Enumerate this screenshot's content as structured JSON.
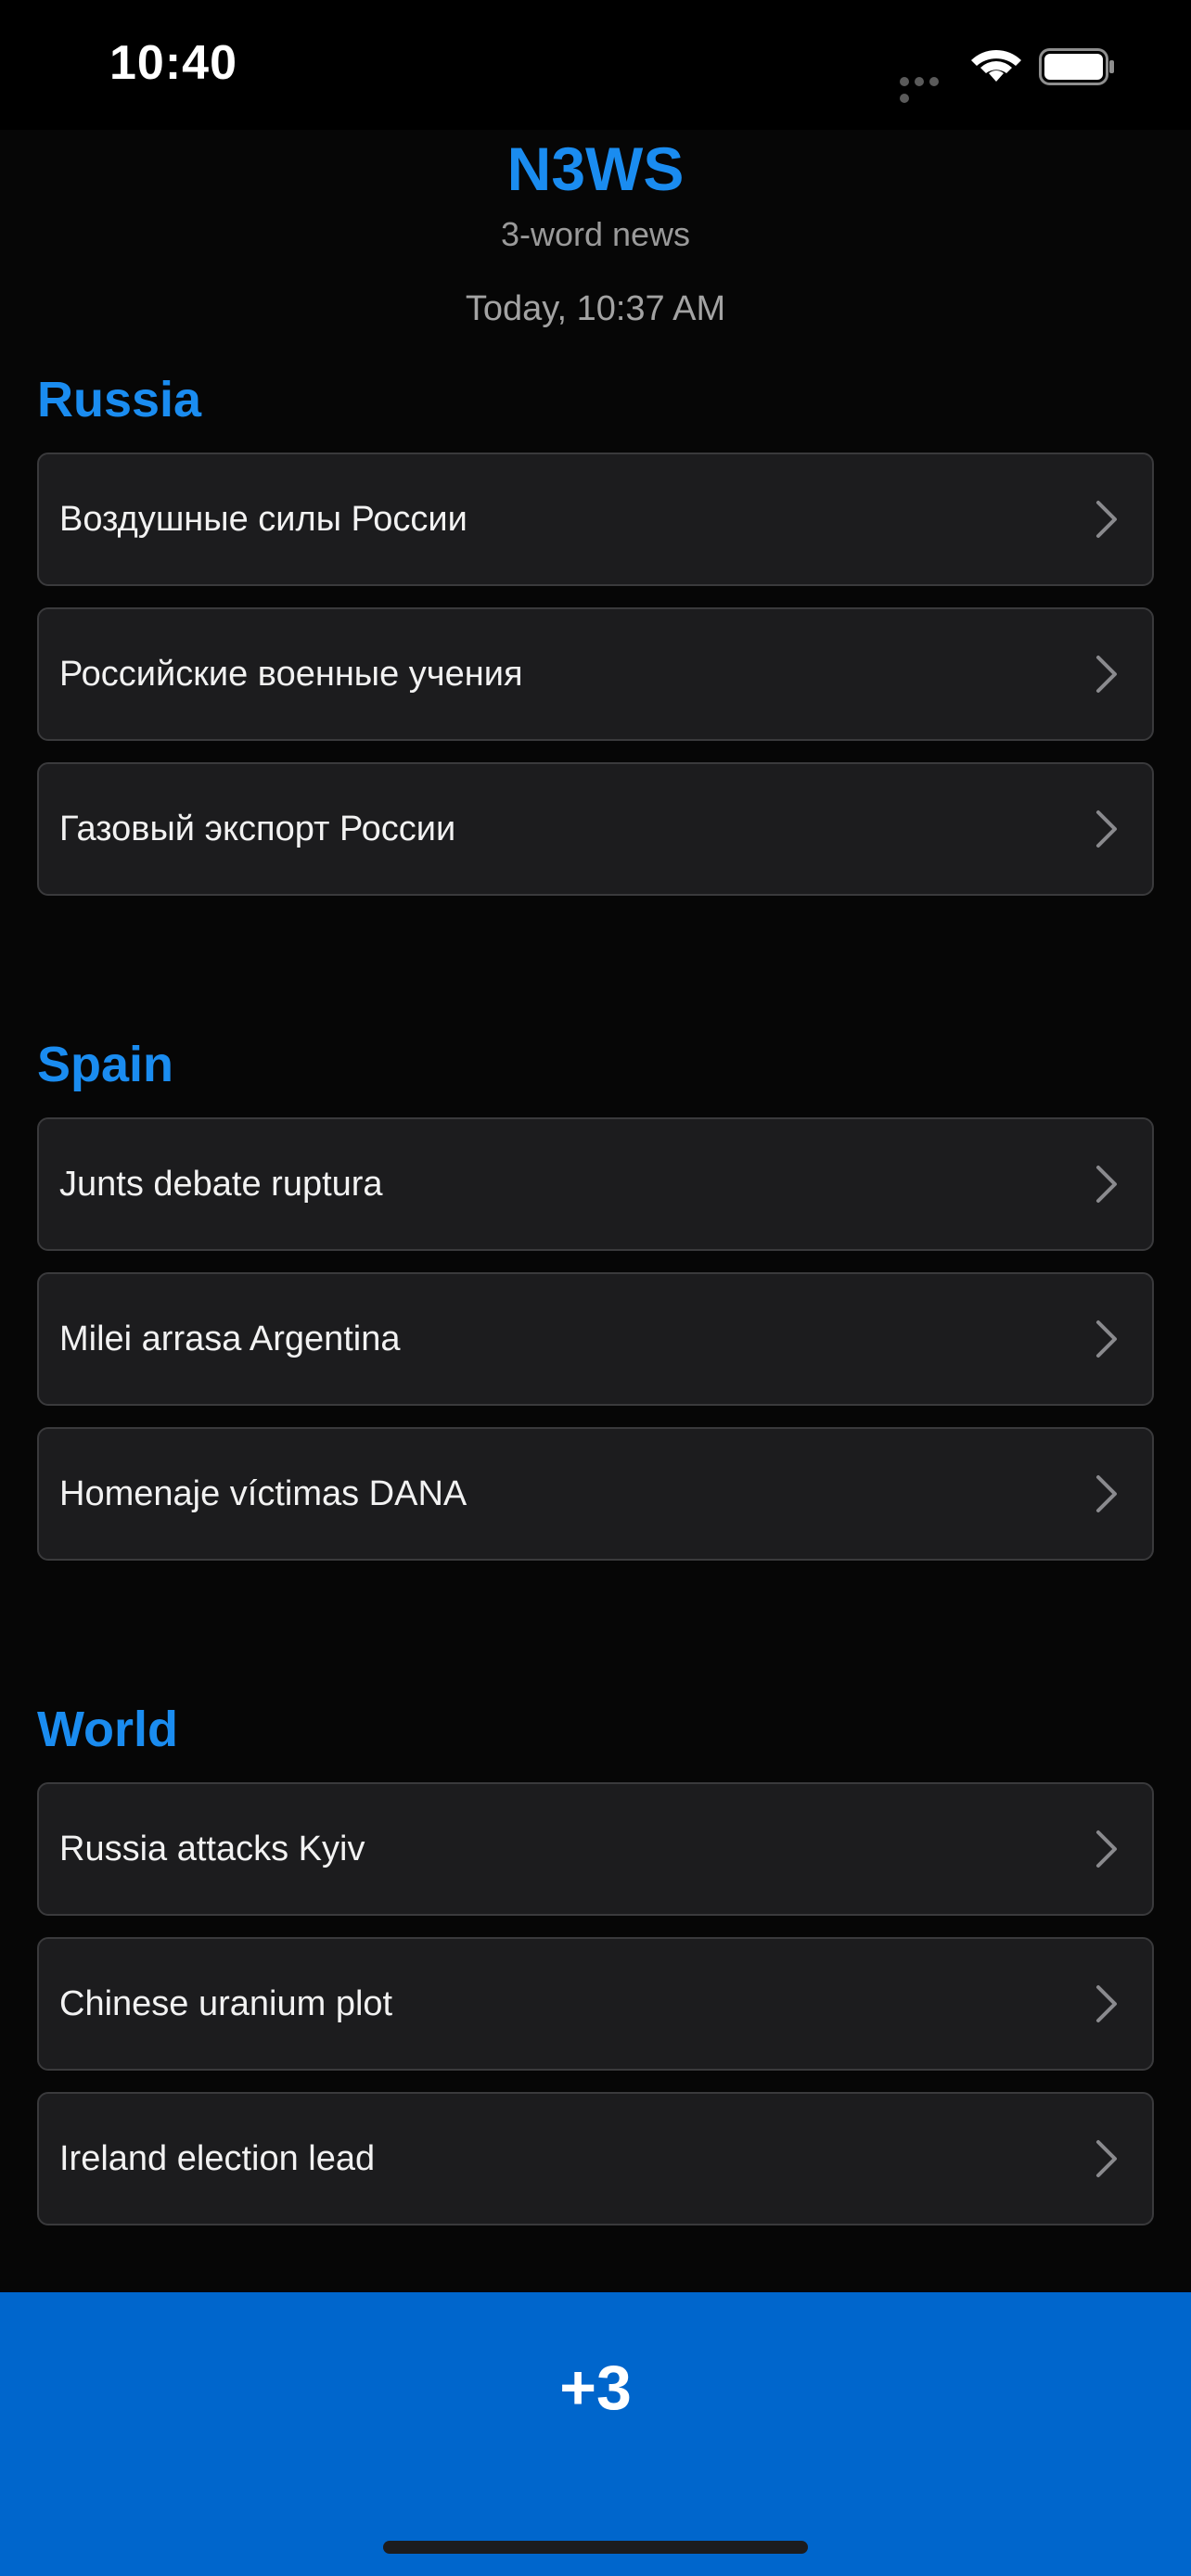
{
  "status_bar": {
    "time": "10:40"
  },
  "header": {
    "title": "N3WS",
    "subtitle": "3-word news",
    "updated": "Today, 10:37 AM"
  },
  "sections": [
    {
      "title": "Russia",
      "items": [
        "Воздушные силы России",
        "Российские военные учения",
        "Газовый экспорт России"
      ]
    },
    {
      "title": "Spain",
      "items": [
        "Junts debate ruptura",
        "Milei arrasa Argentina",
        "Homenaje víctimas DANA"
      ]
    },
    {
      "title": "World",
      "items": [
        "Russia attacks Kyiv",
        "Chinese uranium plot",
        "Ireland election lead"
      ]
    }
  ],
  "bottom_bar": {
    "button_label": "+3"
  },
  "colors": {
    "accent": "#1a8cf0",
    "bottom_bar": "#0066cc",
    "card": "#1c1c1e",
    "background": "#060606"
  },
  "icons": {
    "wifi": "wifi-icon",
    "battery": "battery-icon",
    "chevron": "chevron-right-icon"
  }
}
